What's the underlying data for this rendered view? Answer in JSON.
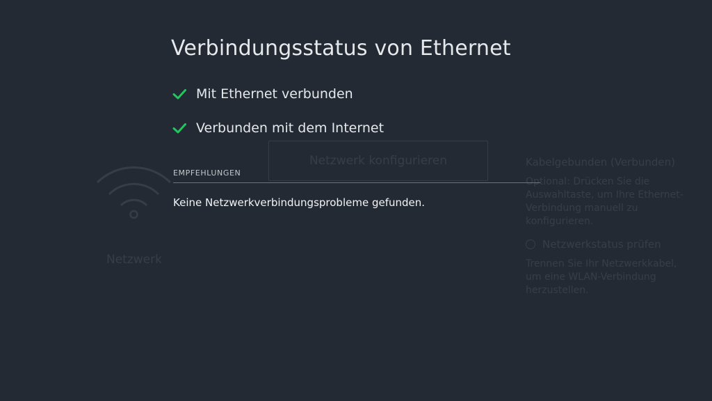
{
  "background": {
    "network_label": "Netzwerk",
    "config_button_label": "Netzwerk konfigurieren",
    "right_panel": {
      "title": "Kabelgebunden (Verbunden)",
      "description": "Optional: Drücken Sie die Auswahltaste, um Ihre Ethernet-Verbindung manuell zu konfigurieren.",
      "check_label": "Netzwerkstatus prüfen",
      "hint": "Trennen Sie Ihr Netzwerkkabel, um eine WLAN-Verbindung herzustellen."
    }
  },
  "dialog": {
    "title": "Verbindungsstatus von Ethernet",
    "status_items": [
      {
        "label": "Mit Ethernet verbunden",
        "icon": "check-icon",
        "color": "#22c55e"
      },
      {
        "label": "Verbunden mit dem Internet",
        "icon": "check-icon",
        "color": "#22c55e"
      }
    ],
    "section_label": "EMPFEHLUNGEN",
    "message": "Keine Netzwerkverbindungsprobleme gefunden."
  },
  "colors": {
    "background": "#232a33",
    "text": "#e6e9ec",
    "success": "#22c55e"
  }
}
